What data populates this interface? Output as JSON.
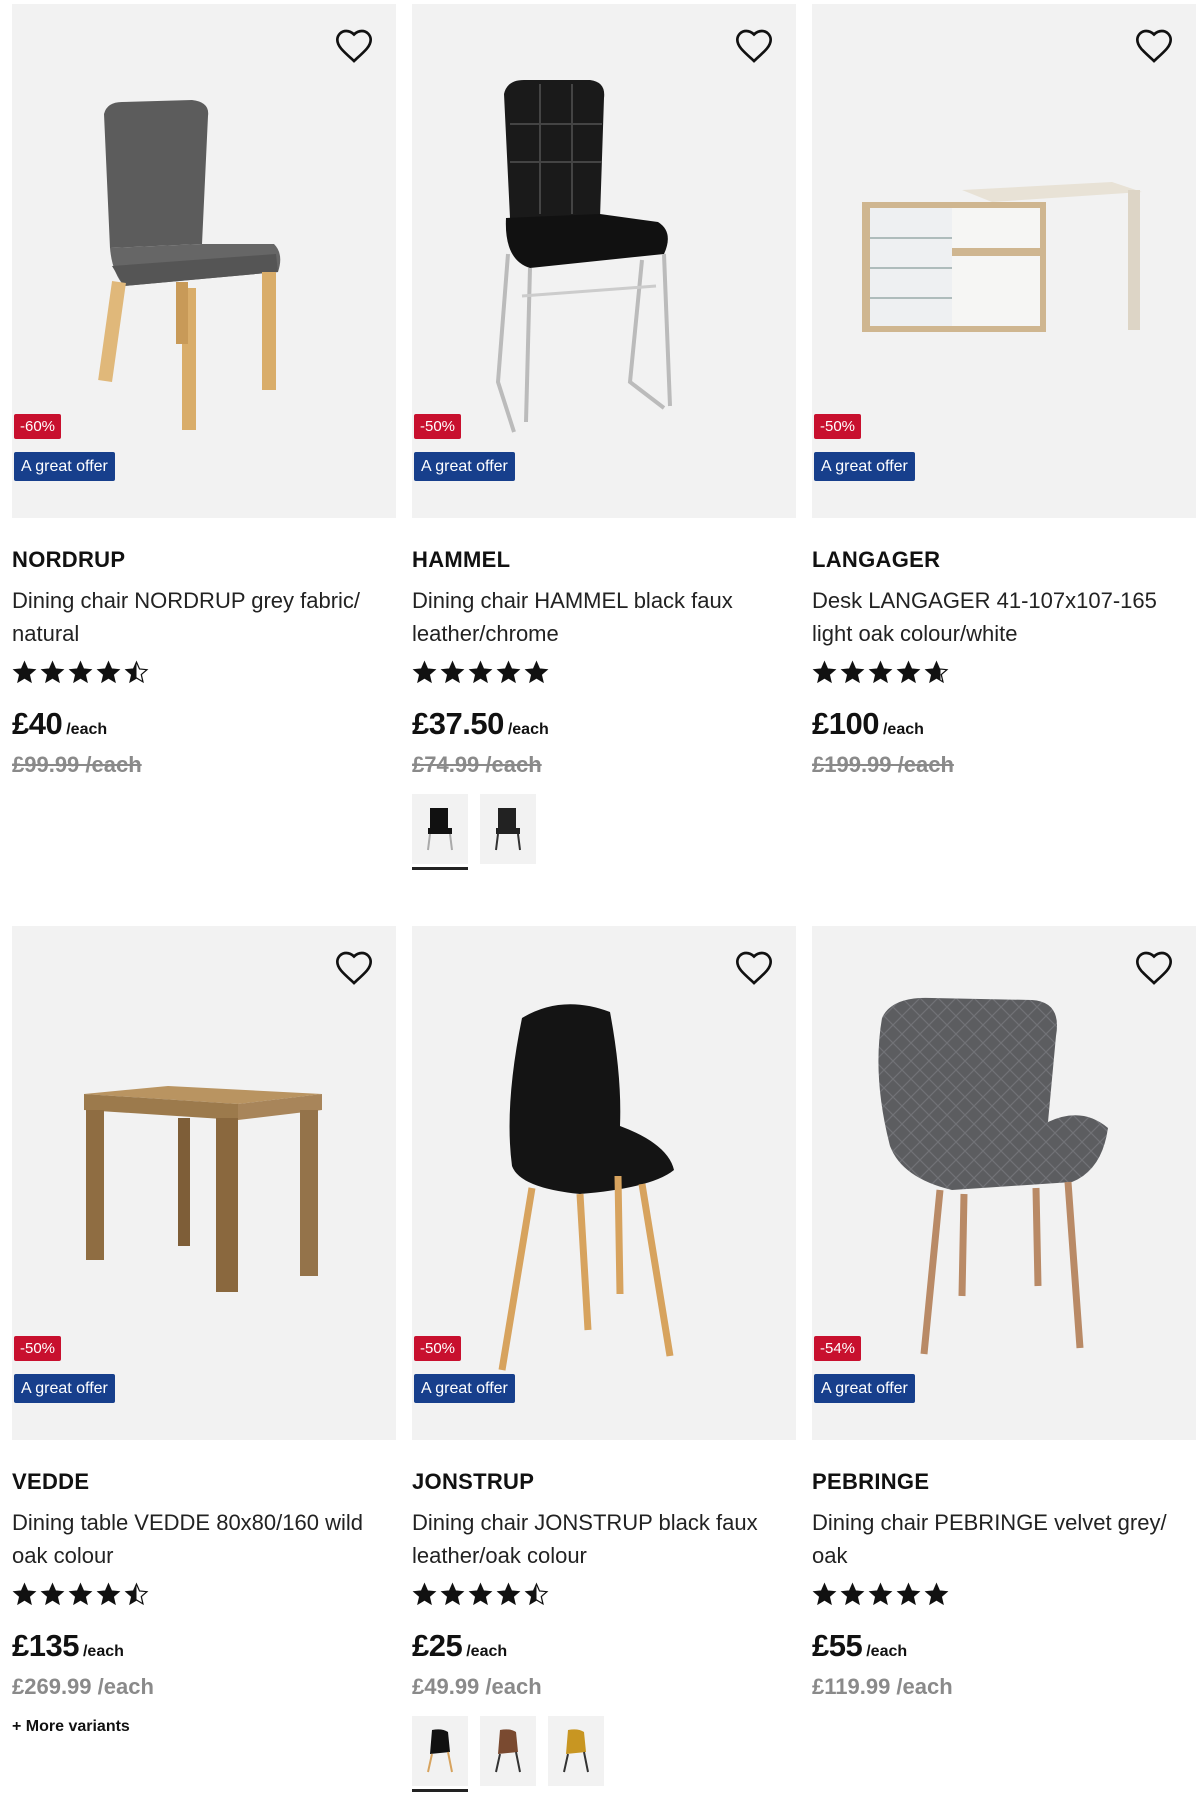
{
  "products": [
    {
      "brand": "NORDRUP",
      "description": "Dining chair NORDRUP grey fabric/ natural",
      "discount": "-60%",
      "offer": "A great offer",
      "rating": 4.5,
      "price": "£40",
      "unit": "/each",
      "old_price": "£99.99 /each",
      "old_struck": true,
      "variants": [],
      "more_variants": ""
    },
    {
      "brand": "HAMMEL",
      "description": "Dining chair HAMMEL black faux leather/chrome",
      "discount": "-50%",
      "offer": "A great offer",
      "rating": 5,
      "price": "£37.50",
      "unit": "/each",
      "old_price": "£74.99 /each",
      "old_struck": true,
      "variants": [
        {
          "name": "black-chrome-chair-variant",
          "selected": true
        },
        {
          "name": "black-black-chair-variant",
          "selected": false
        }
      ],
      "more_variants": ""
    },
    {
      "brand": "LANGAGER",
      "description": "Desk LANGAGER 41-107x107-165 light oak colour/white",
      "discount": "-50%",
      "offer": "A great offer",
      "rating": 4.7,
      "price": "£100",
      "unit": "/each",
      "old_price": "£199.99 /each",
      "old_struck": true,
      "variants": [],
      "more_variants": ""
    },
    {
      "brand": "VEDDE",
      "description": "Dining table VEDDE 80x80/160 wild oak colour",
      "discount": "-50%",
      "offer": "A great offer",
      "rating": 4.5,
      "price": "£135",
      "unit": "/each",
      "old_price": "£269.99 /each",
      "old_struck": false,
      "variants": [],
      "more_variants": "+ More variants"
    },
    {
      "brand": "JONSTRUP",
      "description": "Dining chair JONSTRUP black faux leather/oak colour",
      "discount": "-50%",
      "offer": "A great offer",
      "rating": 4.5,
      "price": "£25",
      "unit": "/each",
      "old_price": "£49.99 /each",
      "old_struck": false,
      "variants": [
        {
          "name": "black-chair-variant",
          "selected": true
        },
        {
          "name": "brown-chair-variant",
          "selected": false
        },
        {
          "name": "yellow-chair-variant",
          "selected": false
        }
      ],
      "more_variants": ""
    },
    {
      "brand": "PEBRINGE",
      "description": "Dining chair PEBRINGE velvet grey/ oak",
      "discount": "-54%",
      "offer": "A great offer",
      "rating": 5,
      "price": "£55",
      "unit": "/each",
      "old_price": "£119.99 /each",
      "old_struck": false,
      "variants": [],
      "more_variants": ""
    }
  ],
  "colors": {
    "discount_bg": "#c8102e",
    "offer_bg": "#173f8c",
    "image_bg": "#f2f2f2"
  }
}
